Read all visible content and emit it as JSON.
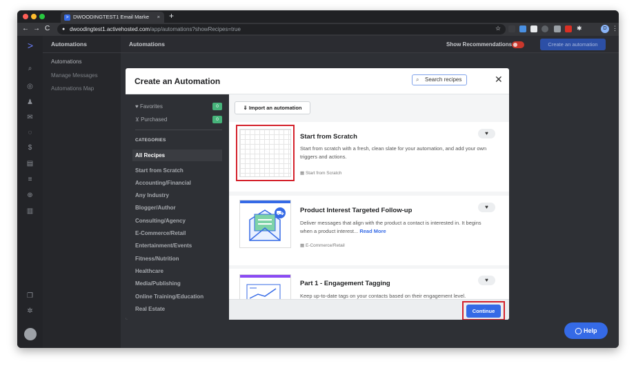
{
  "browser": {
    "tab_title": "DWOODINGTEST1 Email Marke",
    "tab_favicon": "activecampaign-icon",
    "url_host": "dwoodingtest1.activehosted.com",
    "url_path": "/app/automations?showRecipes=true",
    "profile_initial": "D"
  },
  "app": {
    "subnav_title": "Automations",
    "subnav_items": [
      "Automations",
      "Manage Messages",
      "Automations Map"
    ],
    "page_title": "Automations",
    "show_recommendations": "Show Recommendations",
    "create_button": "Create an automation",
    "help_button": "Help"
  },
  "modal": {
    "title": "Create an Automation",
    "search_placeholder": "Search recipes",
    "favorites_label": "Favorites",
    "favorites_count": "0",
    "purchased_label": "Purchased",
    "purchased_count": "0",
    "categories_header": "CATEGORIES",
    "categories": [
      "All Recipes",
      "Start from Scratch",
      "Accounting/Financial",
      "Any Industry",
      "Blogger/Author",
      "Consulting/Agency",
      "E-Commerce/Retail",
      "Entertainment/Events",
      "Fitness/Nutrition",
      "Healthcare",
      "Media/Publishing",
      "Online Training/Education",
      "Real Estate"
    ],
    "import_button": "Import an automation",
    "recipes": [
      {
        "title": "Start from Scratch",
        "description": "Start from scratch with a fresh, clean slate for your automation, and add your own triggers and actions.",
        "read_more": "",
        "tag": "Start from Scratch"
      },
      {
        "title": "Product Interest Targeted Follow-up",
        "description": "Deliver messages that align with the product a contact is interested in. It begins when a product interest...",
        "read_more": "Read More",
        "tag": "E-Commerce/Retail"
      },
      {
        "title": "Part 1 - Engagement Tagging",
        "description": "Keep up-to-date tags on your contacts based on their engagement level.",
        "read_more": "",
        "tag": ""
      }
    ],
    "continue_button": "Continue"
  },
  "colors": {
    "accent": "#356ae6",
    "highlight_box": "#d4202a",
    "badge": "#46b37a",
    "sidebar_dark": "#2e3035"
  }
}
